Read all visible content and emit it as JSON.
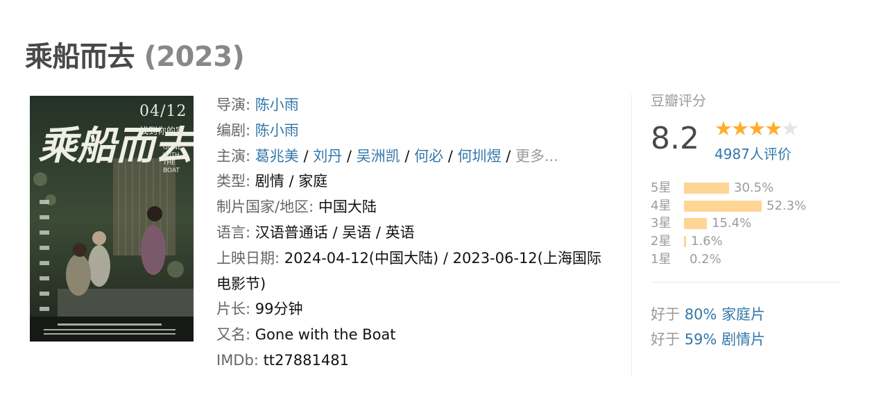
{
  "movie": {
    "title": "乘船而去",
    "year": "(2023)"
  },
  "poster": {
    "title_art": "乘船而去",
    "date": "04/12",
    "tagline": "找到你的家",
    "en_title": "GONE WITH THE BOAT"
  },
  "info": {
    "director": {
      "label": "导演:",
      "names": [
        "陈小雨"
      ]
    },
    "writer": {
      "label": "编剧:",
      "names": [
        "陈小雨"
      ]
    },
    "cast": {
      "label": "主演:",
      "names": [
        "葛兆美",
        "刘丹",
        "吴洲凯",
        "何必",
        "何圳煜"
      ],
      "more": "更多..."
    },
    "genre": {
      "label": "类型:",
      "value": "剧情 / 家庭"
    },
    "region": {
      "label": "制片国家/地区:",
      "value": "中国大陆"
    },
    "language": {
      "label": "语言:",
      "value": "汉语普通话 / 吴语 / 英语"
    },
    "release": {
      "label": "上映日期:",
      "value": "2024-04-12(中国大陆) / 2023-06-12(上海国际电影节)"
    },
    "runtime": {
      "label": "片长:",
      "value": "99分钟"
    },
    "aka": {
      "label": "又名:",
      "value": "Gone with the Boat"
    },
    "imdb": {
      "label": "IMDb:",
      "value": "tt27881481"
    }
  },
  "rating": {
    "header": "豆瓣评分",
    "score": "8.2",
    "stars": 4,
    "count": "4987人评价",
    "distribution": [
      {
        "label": "5星",
        "percent": 30.5,
        "text": "30.5%"
      },
      {
        "label": "4星",
        "percent": 52.3,
        "text": "52.3%"
      },
      {
        "label": "3星",
        "percent": 15.4,
        "text": "15.4%"
      },
      {
        "label": "2星",
        "percent": 1.6,
        "text": "1.6%"
      },
      {
        "label": "1星",
        "percent": 0.2,
        "text": "0.2%"
      }
    ],
    "better_than": [
      {
        "prefix": "好于",
        "percent": "80%",
        "genre": "家庭片"
      },
      {
        "prefix": "好于",
        "percent": "59%",
        "genre": "剧情片"
      }
    ]
  },
  "colors": {
    "link": "#3377aa",
    "star": "#ffac2d",
    "bar": "#ffd596"
  }
}
